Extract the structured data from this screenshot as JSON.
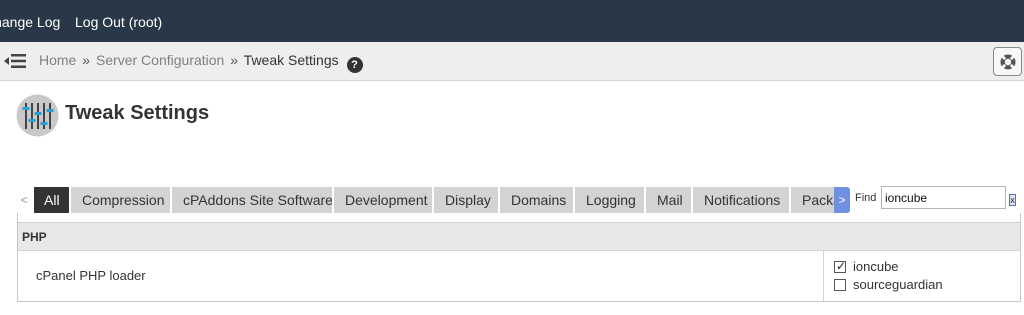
{
  "topbar": {
    "change_log": "Change Log",
    "log_out": "Log Out (root)"
  },
  "breadcrumb": {
    "home": "Home",
    "separator": "»",
    "section": "Server Configuration",
    "current": "Tweak Settings",
    "help_glyph": "?"
  },
  "page": {
    "title": "Tweak Settings",
    "icon": "sliders-icon"
  },
  "tabs": {
    "scroll_left": "<",
    "scroll_right": ">",
    "items": [
      {
        "label": "All",
        "active": true
      },
      {
        "label": "Compression",
        "active": false
      },
      {
        "label": "cPAddons Site Software",
        "active": false
      },
      {
        "label": "Development",
        "active": false
      },
      {
        "label": "Display",
        "active": false
      },
      {
        "label": "Domains",
        "active": false
      },
      {
        "label": "Logging",
        "active": false
      },
      {
        "label": "Mail",
        "active": false
      },
      {
        "label": "Notifications",
        "active": false
      },
      {
        "label": "Packages",
        "active": false
      }
    ]
  },
  "find": {
    "label": "Find",
    "value": "ioncube",
    "clear_glyph": "x"
  },
  "section": {
    "title": "PHP",
    "setting": {
      "name": "cPanel PHP loader",
      "options": [
        {
          "label": "ioncube",
          "checked": true
        },
        {
          "label": "sourceguardian",
          "checked": false
        }
      ]
    }
  },
  "colors": {
    "topbar": "#283848",
    "breadcrumb_bar": "#eeeeee",
    "tab_active": "#333333",
    "tab_inactive": "#d3d3d3",
    "scroll_accent": "#6f8fe0",
    "icon_blue": "#2a9fd6"
  }
}
